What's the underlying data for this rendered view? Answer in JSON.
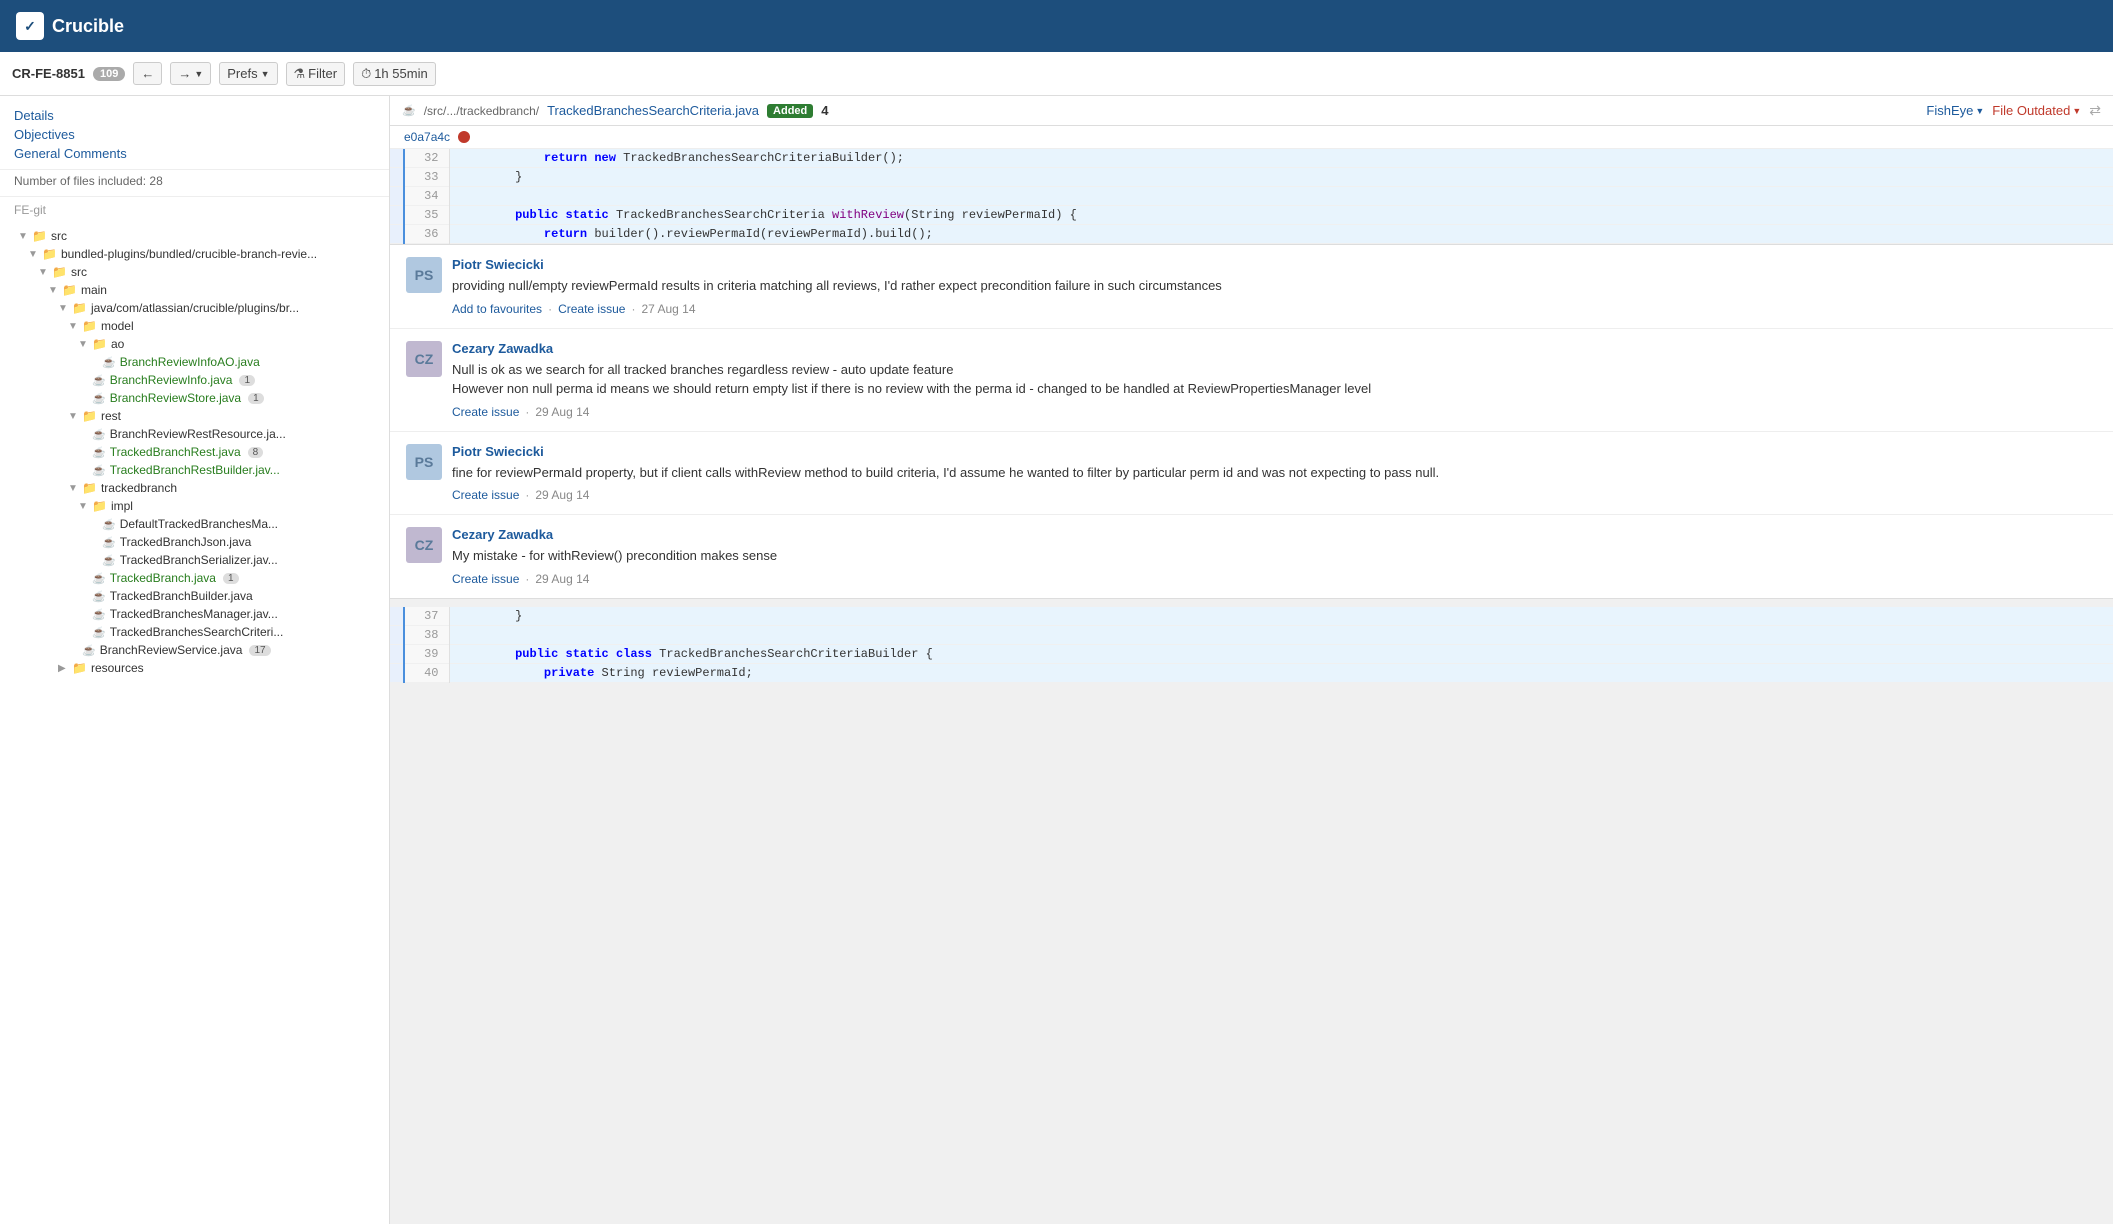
{
  "topbar": {
    "logo_text": "Crucible",
    "logo_icon": "✓"
  },
  "subheader": {
    "review_id": "CR-FE-8851",
    "badge_count": "109",
    "nav_back_icon": "←",
    "nav_forward_icon": "→",
    "prefs_label": "Prefs",
    "filter_label": "Filter",
    "time_label": "1h 55min"
  },
  "sidebar": {
    "nav_links": [
      {
        "label": "Details",
        "id": "details"
      },
      {
        "label": "Objectives",
        "id": "objectives"
      },
      {
        "label": "General Comments",
        "id": "general-comments"
      }
    ],
    "meta_label": "Number of files included: 28",
    "repo_label": "FE-git",
    "tree": [
      {
        "indent": 1,
        "type": "folder",
        "label": "src",
        "expanded": true
      },
      {
        "indent": 2,
        "type": "folder",
        "label": "bundled-plugins/bundled/crucible-branch-revie...",
        "expanded": true
      },
      {
        "indent": 3,
        "type": "folder",
        "label": "src",
        "expanded": true
      },
      {
        "indent": 4,
        "type": "folder",
        "label": "main",
        "expanded": true
      },
      {
        "indent": 5,
        "type": "folder",
        "label": "java/com/atlassian/crucible/plugins/br...",
        "expanded": true
      },
      {
        "indent": 6,
        "type": "folder",
        "label": "model",
        "expanded": true
      },
      {
        "indent": 7,
        "type": "folder",
        "label": "ao",
        "expanded": true
      },
      {
        "indent": 8,
        "type": "file",
        "label": "BranchReviewInfoAO.java",
        "color": "green",
        "badge": null
      },
      {
        "indent": 7,
        "type": "file",
        "label": "BranchReviewInfo.java",
        "color": "green",
        "badge": "1"
      },
      {
        "indent": 7,
        "type": "file",
        "label": "BranchReviewStore.java",
        "color": "green",
        "badge": "1"
      },
      {
        "indent": 6,
        "type": "folder",
        "label": "rest",
        "expanded": true
      },
      {
        "indent": 7,
        "type": "file",
        "label": "BranchReviewRestResource.ja...",
        "color": "dark",
        "badge": null
      },
      {
        "indent": 7,
        "type": "file",
        "label": "TrackedBranchRest.java",
        "color": "green",
        "badge": "8"
      },
      {
        "indent": 7,
        "type": "file",
        "label": "TrackedBranchRestBuilder.jav...",
        "color": "green",
        "badge": null
      },
      {
        "indent": 6,
        "type": "folder",
        "label": "trackedbranch",
        "expanded": true
      },
      {
        "indent": 7,
        "type": "folder",
        "label": "impl",
        "expanded": true
      },
      {
        "indent": 8,
        "type": "file",
        "label": "DefaultTrackedBranchesMa...",
        "color": "dark",
        "badge": null
      },
      {
        "indent": 8,
        "type": "file",
        "label": "TrackedBranchJson.java",
        "color": "dark",
        "badge": null
      },
      {
        "indent": 8,
        "type": "file",
        "label": "TrackedBranchSerializer.jav...",
        "color": "dark",
        "badge": null
      },
      {
        "indent": 7,
        "type": "file",
        "label": "TrackedBranch.java",
        "color": "green",
        "badge": "1"
      },
      {
        "indent": 7,
        "type": "file",
        "label": "TrackedBranchBuilder.java",
        "color": "dark",
        "badge": null
      },
      {
        "indent": 7,
        "type": "file",
        "label": "TrackedBranchesManager.jav...",
        "color": "dark",
        "badge": null
      },
      {
        "indent": 7,
        "type": "file",
        "label": "TrackedBranchesSearchCriteri...",
        "color": "dark",
        "badge": null
      },
      {
        "indent": 6,
        "type": "file",
        "label": "BranchReviewService.java",
        "color": "dark",
        "badge": "17"
      },
      {
        "indent": 5,
        "type": "folder",
        "label": "resources",
        "expanded": false
      }
    ]
  },
  "file_header": {
    "file_icon": "☕",
    "path_prefix": "/src/.../trackedbranch/",
    "file_name": "TrackedBranchesSearchCriteria.java",
    "added_label": "Added",
    "comment_count": "4",
    "fisheye_label": "FishEye",
    "file_outdated_label": "File Outdated"
  },
  "commit": {
    "hash": "e0a7a4c"
  },
  "code_lines_top": [
    {
      "num": "32",
      "highlight": true,
      "text": "            return new TrackedBranchesSearchCriteriaBuilder();"
    },
    {
      "num": "33",
      "highlight": true,
      "text": "        }"
    },
    {
      "num": "34",
      "highlight": true,
      "text": ""
    },
    {
      "num": "35",
      "highlight": true,
      "text": "        public static TrackedBranchesSearchCriteria withReview(String reviewPermaId) {"
    },
    {
      "num": "36",
      "highlight": true,
      "text": "            return builder().reviewPermaId(reviewPermaId).build();"
    }
  ],
  "comments": [
    {
      "id": "c1",
      "author": "Piotr Swiecicki",
      "avatar_initials": "PS",
      "text": "providing null/empty reviewPermaId results in criteria matching all reviews, I'd rather expect precondition failure in such circumstances",
      "actions": [
        "Add to favourites",
        "Create issue"
      ],
      "date": "27 Aug 14"
    },
    {
      "id": "c2",
      "author": "Cezary Zawadka",
      "avatar_initials": "CZ",
      "text": "Null is ok as we search for all tracked branches regardless review - auto update feature\nHowever non null perma id means we should return empty list if there is no review with the perma id - changed to be handled at ReviewPropertiesManager level",
      "actions": [
        "Create issue"
      ],
      "date": "29 Aug 14"
    },
    {
      "id": "c3",
      "author": "Piotr Swiecicki",
      "avatar_initials": "PS",
      "text": "fine for reviewPermaId property, but if client calls withReview method to build criteria, I'd assume he wanted to filter by particular perm id and was not expecting to pass null.",
      "actions": [
        "Create issue"
      ],
      "date": "29 Aug 14"
    },
    {
      "id": "c4",
      "author": "Cezary Zawadka",
      "avatar_initials": "CZ",
      "text": "My mistake - for withReview() precondition makes sense",
      "actions": [
        "Create issue"
      ],
      "date": "29 Aug 14"
    }
  ],
  "code_lines_bottom": [
    {
      "num": "37",
      "highlight": true,
      "text": "        }"
    },
    {
      "num": "38",
      "highlight": true,
      "text": ""
    },
    {
      "num": "39",
      "highlight": true,
      "text": "        public static class TrackedBranchesSearchCriteriaBuilder {"
    },
    {
      "num": "40",
      "highlight": true,
      "text": "            private String reviewPermaId;"
    }
  ]
}
